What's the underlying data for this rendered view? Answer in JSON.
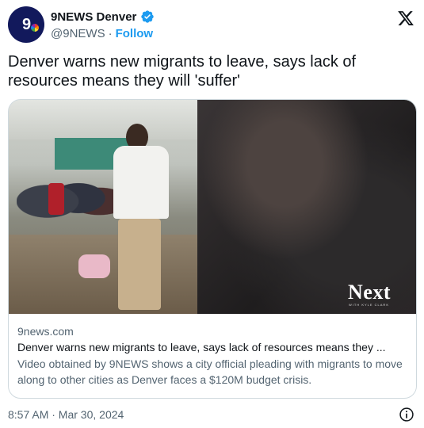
{
  "account": {
    "display_name": "9NEWS Denver",
    "handle": "@9NEWS",
    "separator": "·",
    "follow_label": "Follow",
    "avatar_text": "9"
  },
  "tweet": {
    "text": "Denver warns new migrants to leave, says lack of resources means they will 'suffer'"
  },
  "card": {
    "domain": "9news.com",
    "title": "Denver warns new migrants to leave, says lack of resources means they ...",
    "description": "Video obtained by 9NEWS shows a city official pleading with migrants to move along to other cities as Denver faces a $120M budget crisis.",
    "logo_text": "Next",
    "logo_subtext": "WITH KYLE CLARK"
  },
  "footer": {
    "timestamp": "8:57 AM · Mar 30, 2024"
  },
  "icons": {
    "verified": "verified-badge-icon",
    "x_logo": "x-logo-icon",
    "info": "info-icon"
  },
  "colors": {
    "accent": "#1d9bf0",
    "avatar_bg": "#12195c",
    "muted_text": "#536471"
  }
}
